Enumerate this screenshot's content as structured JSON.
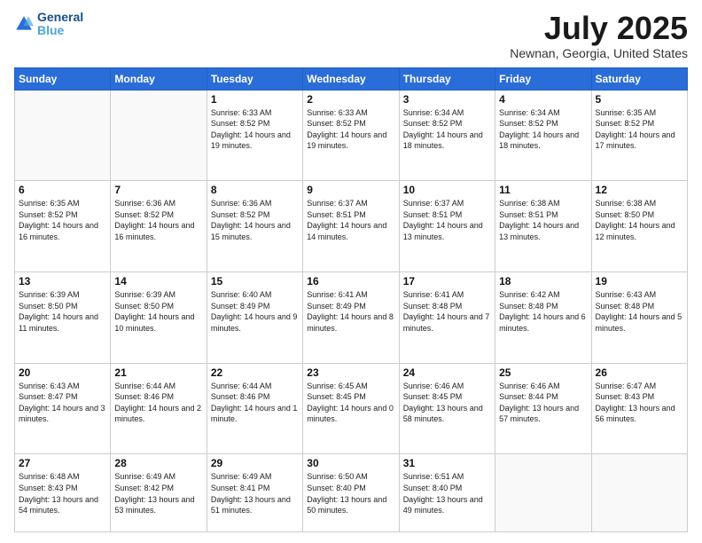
{
  "header": {
    "logo_line1": "General",
    "logo_line2": "Blue",
    "month": "July 2025",
    "location": "Newnan, Georgia, United States"
  },
  "weekdays": [
    "Sunday",
    "Monday",
    "Tuesday",
    "Wednesday",
    "Thursday",
    "Friday",
    "Saturday"
  ],
  "weeks": [
    [
      {
        "day": "",
        "info": ""
      },
      {
        "day": "",
        "info": ""
      },
      {
        "day": "1",
        "info": "Sunrise: 6:33 AM\nSunset: 8:52 PM\nDaylight: 14 hours and 19 minutes."
      },
      {
        "day": "2",
        "info": "Sunrise: 6:33 AM\nSunset: 8:52 PM\nDaylight: 14 hours and 19 minutes."
      },
      {
        "day": "3",
        "info": "Sunrise: 6:34 AM\nSunset: 8:52 PM\nDaylight: 14 hours and 18 minutes."
      },
      {
        "day": "4",
        "info": "Sunrise: 6:34 AM\nSunset: 8:52 PM\nDaylight: 14 hours and 18 minutes."
      },
      {
        "day": "5",
        "info": "Sunrise: 6:35 AM\nSunset: 8:52 PM\nDaylight: 14 hours and 17 minutes."
      }
    ],
    [
      {
        "day": "6",
        "info": "Sunrise: 6:35 AM\nSunset: 8:52 PM\nDaylight: 14 hours and 16 minutes."
      },
      {
        "day": "7",
        "info": "Sunrise: 6:36 AM\nSunset: 8:52 PM\nDaylight: 14 hours and 16 minutes."
      },
      {
        "day": "8",
        "info": "Sunrise: 6:36 AM\nSunset: 8:52 PM\nDaylight: 14 hours and 15 minutes."
      },
      {
        "day": "9",
        "info": "Sunrise: 6:37 AM\nSunset: 8:51 PM\nDaylight: 14 hours and 14 minutes."
      },
      {
        "day": "10",
        "info": "Sunrise: 6:37 AM\nSunset: 8:51 PM\nDaylight: 14 hours and 13 minutes."
      },
      {
        "day": "11",
        "info": "Sunrise: 6:38 AM\nSunset: 8:51 PM\nDaylight: 14 hours and 13 minutes."
      },
      {
        "day": "12",
        "info": "Sunrise: 6:38 AM\nSunset: 8:50 PM\nDaylight: 14 hours and 12 minutes."
      }
    ],
    [
      {
        "day": "13",
        "info": "Sunrise: 6:39 AM\nSunset: 8:50 PM\nDaylight: 14 hours and 11 minutes."
      },
      {
        "day": "14",
        "info": "Sunrise: 6:39 AM\nSunset: 8:50 PM\nDaylight: 14 hours and 10 minutes."
      },
      {
        "day": "15",
        "info": "Sunrise: 6:40 AM\nSunset: 8:49 PM\nDaylight: 14 hours and 9 minutes."
      },
      {
        "day": "16",
        "info": "Sunrise: 6:41 AM\nSunset: 8:49 PM\nDaylight: 14 hours and 8 minutes."
      },
      {
        "day": "17",
        "info": "Sunrise: 6:41 AM\nSunset: 8:48 PM\nDaylight: 14 hours and 7 minutes."
      },
      {
        "day": "18",
        "info": "Sunrise: 6:42 AM\nSunset: 8:48 PM\nDaylight: 14 hours and 6 minutes."
      },
      {
        "day": "19",
        "info": "Sunrise: 6:43 AM\nSunset: 8:48 PM\nDaylight: 14 hours and 5 minutes."
      }
    ],
    [
      {
        "day": "20",
        "info": "Sunrise: 6:43 AM\nSunset: 8:47 PM\nDaylight: 14 hours and 3 minutes."
      },
      {
        "day": "21",
        "info": "Sunrise: 6:44 AM\nSunset: 8:46 PM\nDaylight: 14 hours and 2 minutes."
      },
      {
        "day": "22",
        "info": "Sunrise: 6:44 AM\nSunset: 8:46 PM\nDaylight: 14 hours and 1 minute."
      },
      {
        "day": "23",
        "info": "Sunrise: 6:45 AM\nSunset: 8:45 PM\nDaylight: 14 hours and 0 minutes."
      },
      {
        "day": "24",
        "info": "Sunrise: 6:46 AM\nSunset: 8:45 PM\nDaylight: 13 hours and 58 minutes."
      },
      {
        "day": "25",
        "info": "Sunrise: 6:46 AM\nSunset: 8:44 PM\nDaylight: 13 hours and 57 minutes."
      },
      {
        "day": "26",
        "info": "Sunrise: 6:47 AM\nSunset: 8:43 PM\nDaylight: 13 hours and 56 minutes."
      }
    ],
    [
      {
        "day": "27",
        "info": "Sunrise: 6:48 AM\nSunset: 8:43 PM\nDaylight: 13 hours and 54 minutes."
      },
      {
        "day": "28",
        "info": "Sunrise: 6:49 AM\nSunset: 8:42 PM\nDaylight: 13 hours and 53 minutes."
      },
      {
        "day": "29",
        "info": "Sunrise: 6:49 AM\nSunset: 8:41 PM\nDaylight: 13 hours and 51 minutes."
      },
      {
        "day": "30",
        "info": "Sunrise: 6:50 AM\nSunset: 8:40 PM\nDaylight: 13 hours and 50 minutes."
      },
      {
        "day": "31",
        "info": "Sunrise: 6:51 AM\nSunset: 8:40 PM\nDaylight: 13 hours and 49 minutes."
      },
      {
        "day": "",
        "info": ""
      },
      {
        "day": "",
        "info": ""
      }
    ]
  ]
}
